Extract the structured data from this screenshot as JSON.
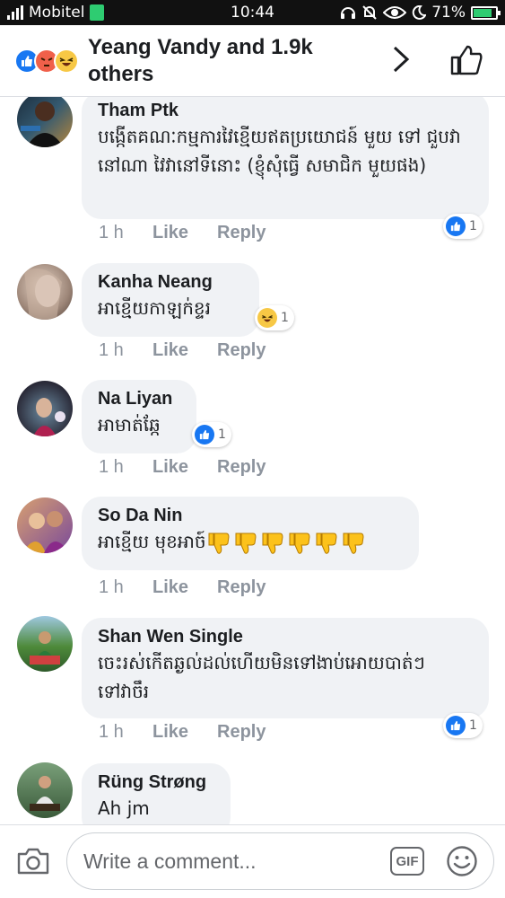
{
  "status_bar": {
    "carrier": "Mobitel",
    "time": "10:44",
    "battery": "71%"
  },
  "header": {
    "title": "Yeang Vandy and 1.9k others",
    "reactions": [
      "like",
      "angry",
      "haha"
    ]
  },
  "comments": [
    {
      "name": "Tham Ptk",
      "text": "បង្កើតគណៈកម្មការវៃខ្មើយឥតប្រយោជន៍ មួយ ទៅ ជួបវានៅណា វៃវានៅទីនោះ (ខ្ញុំសុំធ្វើ សមាជិក មួយផង)",
      "time": "1 h",
      "like_label": "Like",
      "reply_label": "Reply",
      "reaction": {
        "icon": "like",
        "count": "1"
      }
    },
    {
      "name": "Kanha Neang",
      "text": "អាខ្មើយកាឡក់ខ្ទរ",
      "time": "1 h",
      "like_label": "Like",
      "reply_label": "Reply",
      "reaction": {
        "icon": "haha",
        "count": "1"
      }
    },
    {
      "name": "Na Liyan",
      "text": "អាមាត់ឆ្កែ",
      "time": "1 h",
      "like_label": "Like",
      "reply_label": "Reply",
      "reaction": {
        "icon": "like",
        "count": "1"
      }
    },
    {
      "name": "So Da Nin",
      "text": "អាខ្មើយ មុខអាច៍",
      "emoji": [
        "thumbs-down",
        "thumbs-down",
        "thumbs-down",
        "thumbs-down",
        "thumbs-down",
        "thumbs-down"
      ],
      "time": "1 h",
      "like_label": "Like",
      "reply_label": "Reply"
    },
    {
      "name": "Shan Wen Single",
      "text": "ចេះរស់កើតឆ្ងល់ដល់ហើយមិនទៅងាប់អោយបាត់ៗទៅវាចឹរ",
      "time": "1 h",
      "like_label": "Like",
      "reply_label": "Reply",
      "reaction": {
        "icon": "like",
        "count": "1"
      }
    },
    {
      "name": "Rüng Strøng",
      "text": "Ah jm"
    }
  ],
  "composer": {
    "placeholder": "Write a comment...",
    "gif_label": "GIF"
  },
  "colors": {
    "accent": "#1877f2",
    "bubble": "#f0f2f5",
    "meta": "#8d949e"
  }
}
